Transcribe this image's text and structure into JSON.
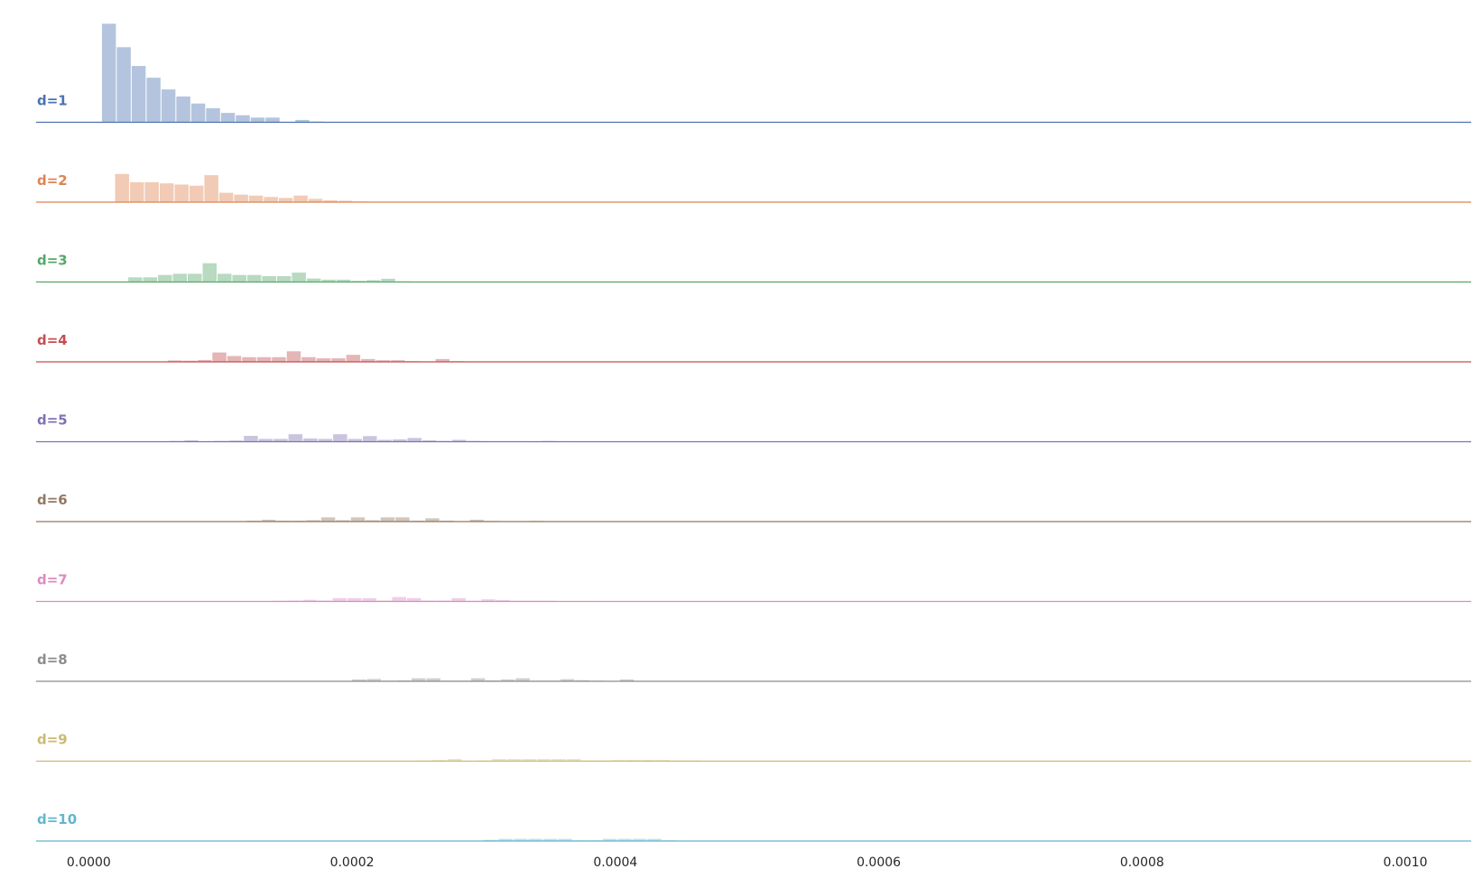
{
  "chart_data": {
    "type": "histogram-ridgeline",
    "title": "",
    "xlabel": "",
    "ylabel": "",
    "xlim": [
      -4e-05,
      0.00105
    ],
    "grid": false,
    "bin_width": 1.13e-05,
    "x_ticks": [
      0.0,
      0.0002,
      0.0004,
      0.0006,
      0.0008,
      0.001
    ],
    "x_tick_labels": [
      "0.0000",
      "0.0002",
      "0.0004",
      "0.0006",
      "0.0008",
      "0.0010"
    ],
    "series": [
      {
        "name": "d=1",
        "color": "#4c72b0",
        "start": 1e-05,
        "counts": [
          42,
          32,
          24,
          19,
          14,
          11,
          8,
          6,
          4,
          3,
          2,
          2,
          0,
          1,
          0.3,
          0.2
        ]
      },
      {
        "name": "d=2",
        "color": "#dd8452",
        "start": 2e-05,
        "counts": [
          12,
          8.5,
          8.5,
          8,
          7.5,
          7,
          11.5,
          4,
          3.2,
          2.8,
          2.2,
          1.8,
          2.8,
          1.4,
          0.8,
          0.6,
          0.3
        ]
      },
      {
        "name": "d=3",
        "color": "#55a868",
        "start": 3e-05,
        "counts": [
          2,
          2,
          3,
          3.5,
          3.5,
          8,
          3.5,
          3,
          3,
          2.5,
          2.5,
          4,
          1.5,
          1,
          1,
          0.5,
          0.8,
          1.4,
          0.3
        ]
      },
      {
        "name": "d=4",
        "color": "#c44e52",
        "start": 6e-05,
        "counts": [
          0.6,
          0.5,
          0.8,
          4,
          2.5,
          2,
          2,
          2,
          4.5,
          2,
          1.5,
          1.5,
          3,
          1.2,
          0.7,
          0.7,
          0.3,
          0.2,
          1.2,
          0.3
        ]
      },
      {
        "name": "d=5",
        "color": "#8172b3",
        "start": 5e-05,
        "counts": [
          0,
          0.3,
          0.6,
          0,
          0.3,
          0.5,
          2.5,
          1.2,
          1.2,
          3.2,
          1.4,
          1.2,
          3.2,
          1.2,
          2.4,
          0.8,
          1,
          1.6,
          0.6,
          0.3,
          0.8,
          0.3,
          0.2,
          0.2,
          0.2,
          0,
          0.3,
          0.2
        ]
      },
      {
        "name": "d=6",
        "color": "#937860",
        "start": 0.00012,
        "counts": [
          0.4,
          0.8,
          0.4,
          0.4,
          0.6,
          1.8,
          0.6,
          1.8,
          0.6,
          1.8,
          1.8,
          0.4,
          1.4,
          0.4,
          0.2,
          0.8,
          0.3,
          0,
          0.2,
          0.3,
          0.2,
          0.1
        ]
      },
      {
        "name": "d=7",
        "color": "#da8bc3",
        "start": 0.00014,
        "counts": [
          0.3,
          0.4,
          0.7,
          0.4,
          1.4,
          1.4,
          1.4,
          0.4,
          1.9,
          1.4,
          0.4,
          0.4,
          1.4,
          0.3,
          0.9,
          0.6,
          0.3,
          0.3,
          0.3,
          0.2,
          0.2,
          0.2
        ]
      },
      {
        "name": "d=8",
        "color": "#8c8c8c",
        "start": 0.0002,
        "counts": [
          0.8,
          1,
          0.3,
          0.4,
          1.3,
          1.3,
          0.3,
          0.3,
          1.3,
          0.4,
          0.8,
          1.3,
          0.3,
          0.3,
          0.9,
          0.5,
          0.3,
          0,
          0.8,
          0.2
        ]
      },
      {
        "name": "d=9",
        "color": "#ccb974",
        "start": 0.00025,
        "counts": [
          0.3,
          0.5,
          0.9,
          0.2,
          0.3,
          0.9,
          0.9,
          0.9,
          0.9,
          0.9,
          0.9,
          0.3,
          0.3,
          0.5,
          0.5,
          0.5,
          0.5,
          0.3,
          0.3,
          0.2,
          0.2,
          0.2,
          0.2,
          0.2
        ]
      },
      {
        "name": "d=10",
        "color": "#64b5cd",
        "start": 0.0003,
        "counts": [
          0.5,
          0.9,
          0.9,
          0.9,
          0.9,
          0.9,
          0.3,
          0.3,
          0.9,
          0.9,
          0.9,
          0.9,
          0.3,
          0.2,
          0.2,
          0.2,
          0.2,
          0.2,
          0.2,
          0.2
        ]
      }
    ]
  }
}
